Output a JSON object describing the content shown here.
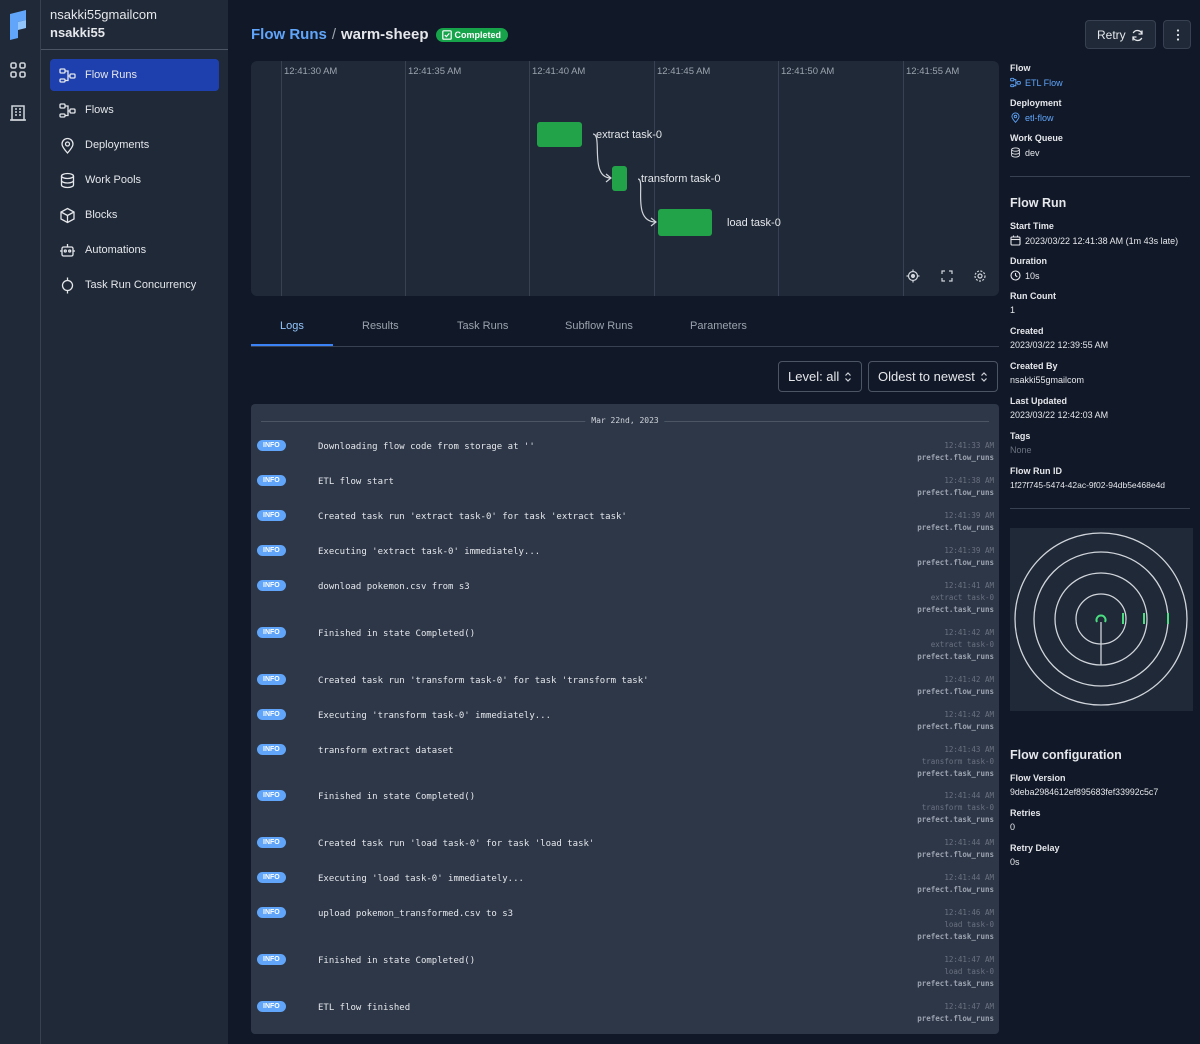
{
  "workspace": {
    "account": "nsakki55gmailcom",
    "name": "nsakki55"
  },
  "sidebar": {
    "items": [
      {
        "label": "Flow Runs",
        "icon": "flow-runs-icon",
        "active": true
      },
      {
        "label": "Flows",
        "icon": "flows-icon"
      },
      {
        "label": "Deployments",
        "icon": "map-pin-icon"
      },
      {
        "label": "Work Pools",
        "icon": "database-icon"
      },
      {
        "label": "Blocks",
        "icon": "cube-icon"
      },
      {
        "label": "Automations",
        "icon": "robot-icon"
      },
      {
        "label": "Task Run Concurrency",
        "icon": "concurrency-icon"
      }
    ]
  },
  "header": {
    "breadcrumb": "Flow Runs",
    "separator": "/",
    "run_name": "warm-sheep",
    "state": "Completed",
    "retry_label": "Retry",
    "accent": "#60a5fa",
    "success": "#16a34a"
  },
  "timeline": {
    "ticks": [
      "12:41:30 AM",
      "12:41:35 AM",
      "12:41:40 AM",
      "12:41:45 AM",
      "12:41:50 AM",
      "12:41:55 AM"
    ],
    "tasks": [
      {
        "name": "extract task-0",
        "start": "12:41:39 AM",
        "end": "12:41:41 AM"
      },
      {
        "name": "transform task-0",
        "start": "12:41:42 AM",
        "end": "12:41:43 AM"
      },
      {
        "name": "load task-0",
        "start": "12:41:45 AM",
        "end": "12:41:47 AM"
      }
    ]
  },
  "tabs": [
    "Logs",
    "Results",
    "Task Runs",
    "Subflow Runs",
    "Parameters"
  ],
  "filters": {
    "level": "Level: all",
    "order": "Oldest to newest"
  },
  "logs": {
    "date": "Mar 22nd, 2023",
    "entries": [
      {
        "level": "INFO",
        "message": "Downloading flow code from storage at ''",
        "time": "12:41:33 AM",
        "task": "",
        "logger": "prefect.flow_runs"
      },
      {
        "level": "INFO",
        "message": "ETL flow start",
        "time": "12:41:38 AM",
        "task": "",
        "logger": "prefect.flow_runs"
      },
      {
        "level": "INFO",
        "message": "Created task run 'extract task-0' for task 'extract task'",
        "time": "12:41:39 AM",
        "task": "",
        "logger": "prefect.flow_runs"
      },
      {
        "level": "INFO",
        "message": "Executing 'extract task-0' immediately...",
        "time": "12:41:39 AM",
        "task": "",
        "logger": "prefect.flow_runs"
      },
      {
        "level": "INFO",
        "message": "download pokemon.csv from s3",
        "time": "12:41:41 AM",
        "task": "extract task-0",
        "logger": "prefect.task_runs"
      },
      {
        "level": "INFO",
        "message": "Finished in state Completed()",
        "time": "12:41:42 AM",
        "task": "extract task-0",
        "logger": "prefect.task_runs"
      },
      {
        "level": "INFO",
        "message": "Created task run 'transform task-0' for task 'transform task'",
        "time": "12:41:42 AM",
        "task": "",
        "logger": "prefect.flow_runs"
      },
      {
        "level": "INFO",
        "message": "Executing 'transform task-0' immediately...",
        "time": "12:41:42 AM",
        "task": "",
        "logger": "prefect.flow_runs"
      },
      {
        "level": "INFO",
        "message": "transform extract dataset",
        "time": "12:41:43 AM",
        "task": "transform task-0",
        "logger": "prefect.task_runs"
      },
      {
        "level": "INFO",
        "message": "Finished in state Completed()",
        "time": "12:41:44 AM",
        "task": "transform task-0",
        "logger": "prefect.task_runs"
      },
      {
        "level": "INFO",
        "message": "Created task run 'load task-0' for task 'load task'",
        "time": "12:41:44 AM",
        "task": "",
        "logger": "prefect.flow_runs"
      },
      {
        "level": "INFO",
        "message": "Executing 'load task-0' immediately...",
        "time": "12:41:44 AM",
        "task": "",
        "logger": "prefect.flow_runs"
      },
      {
        "level": "INFO",
        "message": "upload pokemon_transformed.csv to s3",
        "time": "12:41:46 AM",
        "task": "load task-0",
        "logger": "prefect.task_runs"
      },
      {
        "level": "INFO",
        "message": "Finished in state Completed()",
        "time": "12:41:47 AM",
        "task": "load task-0",
        "logger": "prefect.task_runs"
      },
      {
        "level": "INFO",
        "message": "ETL flow finished",
        "time": "12:41:47 AM",
        "task": "",
        "logger": "prefect.flow_runs"
      }
    ]
  },
  "details": {
    "flow_label": "Flow",
    "flow": "ETL Flow",
    "deployment_label": "Deployment",
    "deployment": "etl-flow",
    "work_queue_label": "Work Queue",
    "work_queue": "dev",
    "flow_run_heading": "Flow Run",
    "start_time_label": "Start Time",
    "start_time": "2023/03/22 12:41:38 AM (1m 43s late)",
    "duration_label": "Duration",
    "duration": "10s",
    "run_count_label": "Run Count",
    "run_count": "1",
    "created_label": "Created",
    "created": "2023/03/22 12:39:55 AM",
    "created_by_label": "Created By",
    "created_by": "nsakki55gmailcom",
    "last_updated_label": "Last Updated",
    "last_updated": "2023/03/22 12:42:03 AM",
    "tags_label": "Tags",
    "tags": "None",
    "flow_run_id_label": "Flow Run ID",
    "flow_run_id": "1f27f745-5474-42ac-9f02-94db5e468e4d",
    "config_heading": "Flow configuration",
    "flow_version_label": "Flow Version",
    "flow_version": "9deba2984612ef895683fef33992c5c7",
    "retries_label": "Retries",
    "retries": "0",
    "retry_delay_label": "Retry Delay",
    "retry_delay": "0s"
  }
}
